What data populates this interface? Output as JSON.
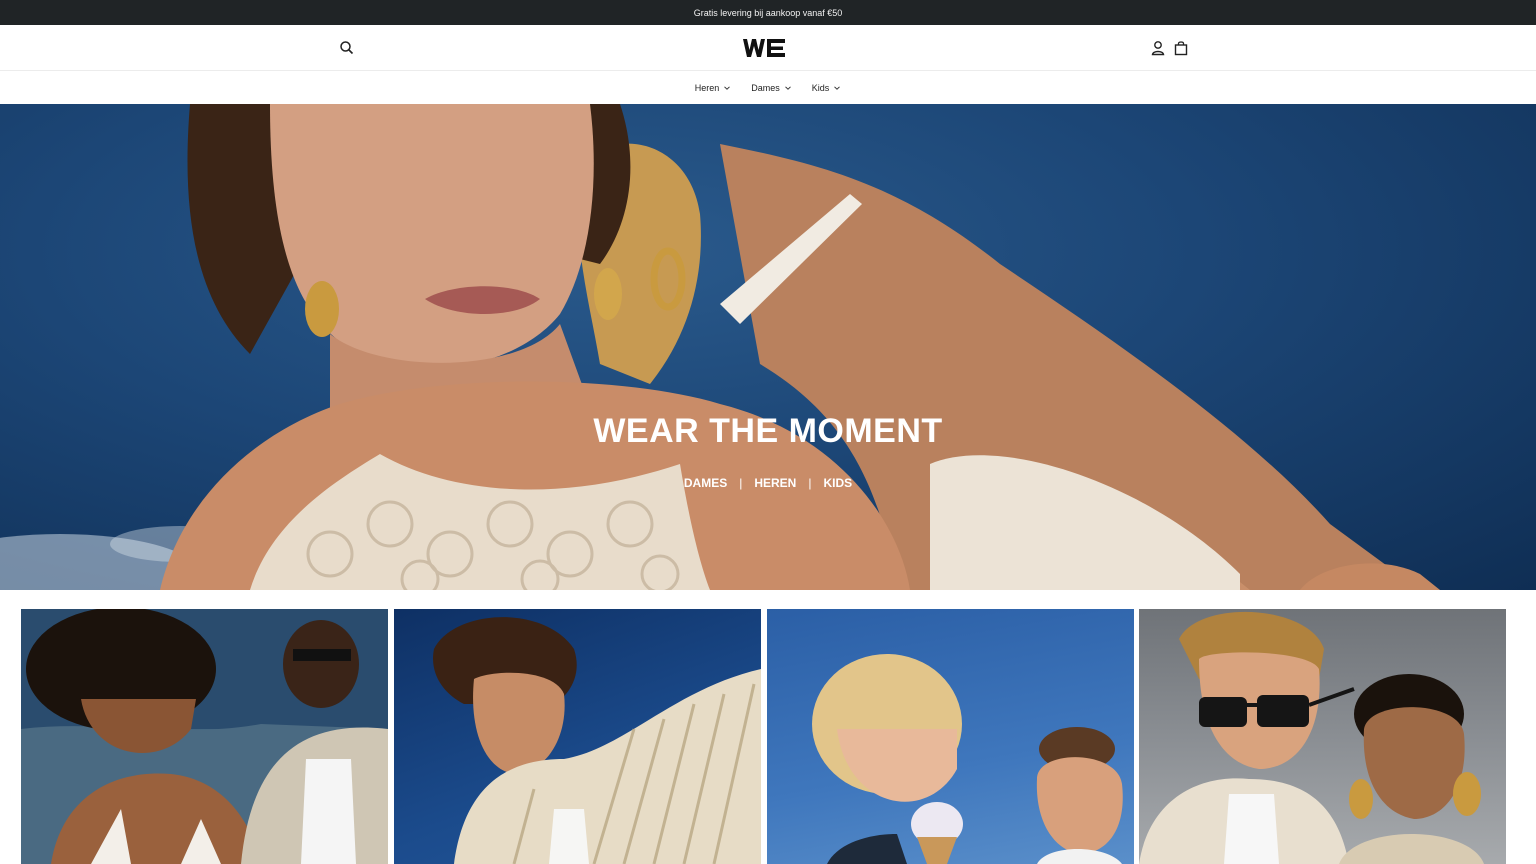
{
  "announcement": "Gratis levering bij aankoop vanaf €50",
  "header": {
    "logo_text": "WE",
    "icons": {
      "search": "search-icon",
      "account": "user-icon",
      "cart": "shopping-bag-icon"
    }
  },
  "nav": {
    "items": [
      {
        "label": "Heren"
      },
      {
        "label": "Dames"
      },
      {
        "label": "Kids"
      }
    ]
  },
  "hero": {
    "title": "WEAR THE MOMENT",
    "links": [
      "DAMES",
      "HEREN",
      "KIDS"
    ],
    "separator": "|"
  },
  "tiles": [
    {
      "image": "couple-beach-photo"
    },
    {
      "image": "man-striped-shirt-photo"
    },
    {
      "image": "kids-ice-cream-photo"
    },
    {
      "image": "couple-sunglasses-photo"
    }
  ],
  "colors": {
    "announcement_bg": "#202426",
    "hero_sky": "#1c4676",
    "text": "#111111"
  }
}
